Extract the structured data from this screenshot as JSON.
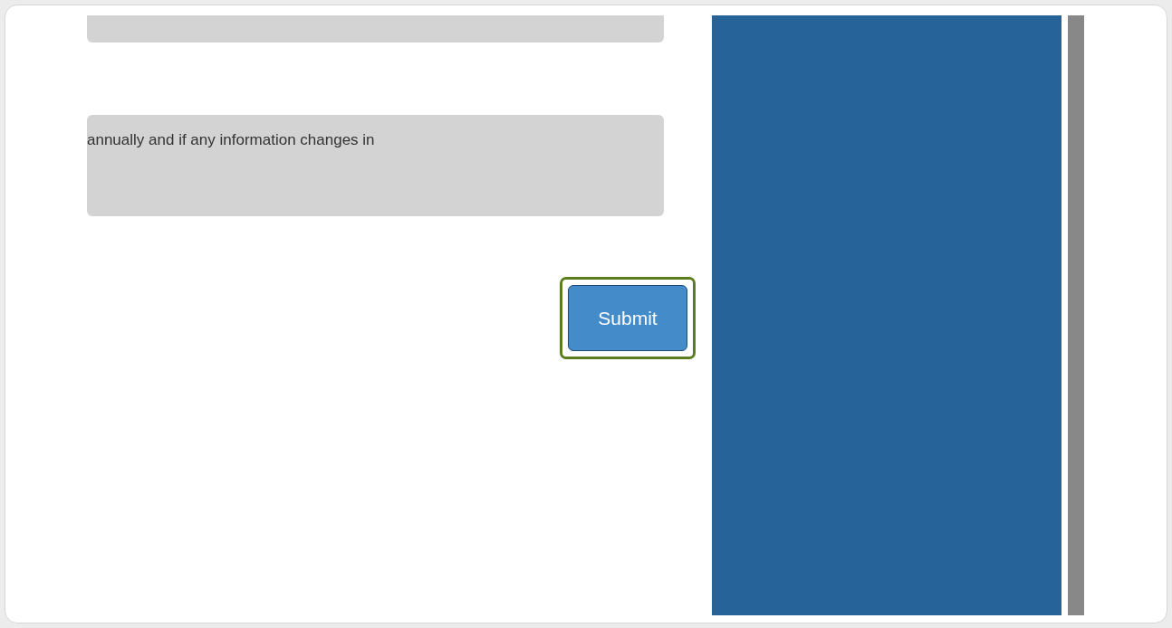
{
  "form": {
    "fields": [
      {
        "kind": "input"
      },
      {
        "kind": "textarea",
        "value": "annually and if any information changes in"
      }
    ],
    "submit": {
      "label": "Submit",
      "highlighted": true
    }
  }
}
